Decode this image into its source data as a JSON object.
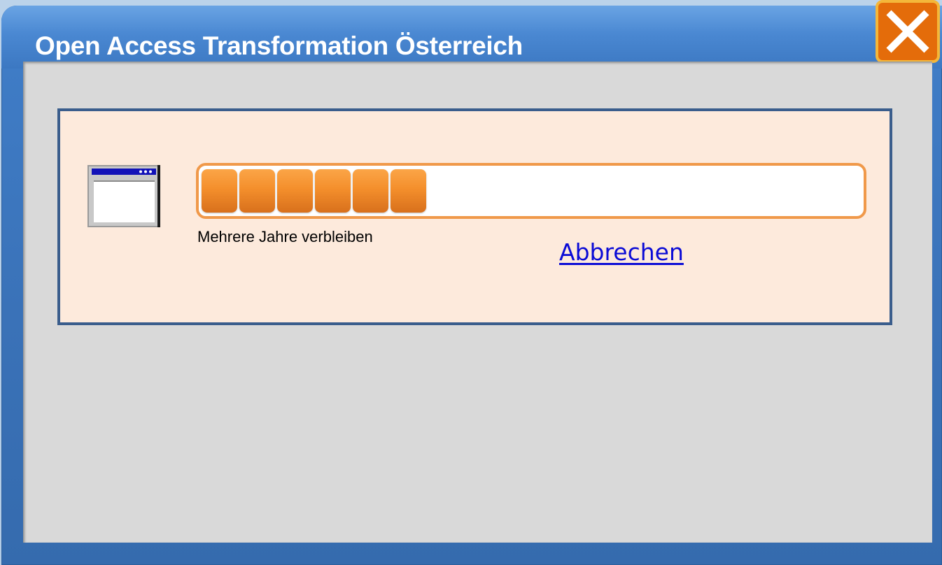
{
  "window": {
    "title": "Open Access Transformation Österreich",
    "close_icon": "close-x-icon"
  },
  "dialog": {
    "app_icon": "window-icon",
    "progress": {
      "filled_segments": 6,
      "fraction": 0.33,
      "color": "#f48f2c"
    },
    "status_text": "Mehrere Jahre verbleiben",
    "cancel_label": "Abbrechen"
  },
  "colors": {
    "title_bar": "#4a88d2",
    "close_button": "#e46c0a",
    "panel_background": "#fdeadc",
    "panel_border": "#3a5d8c",
    "link": "#0b0bd6"
  }
}
